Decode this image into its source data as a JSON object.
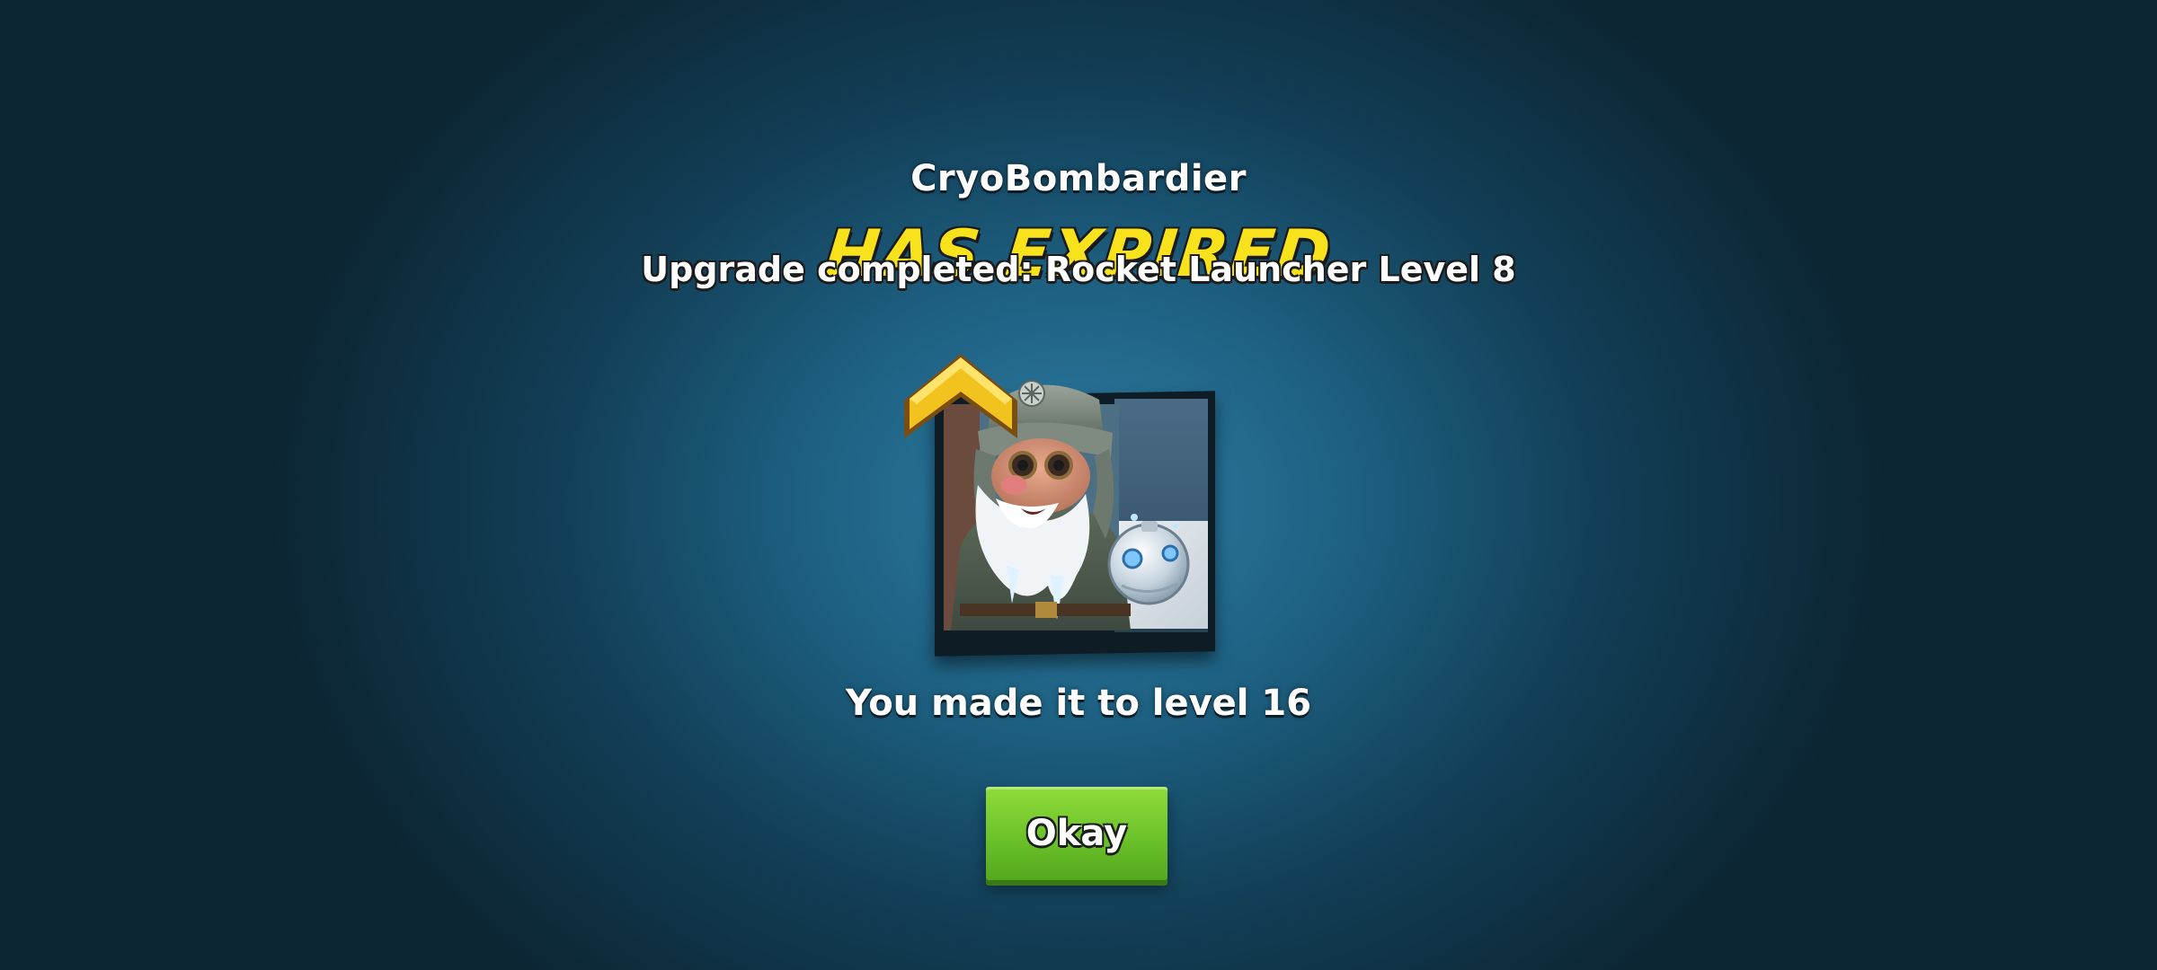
{
  "dialog": {
    "hero_name": "CryoBombardier",
    "expired_banner": "HAS EXPIRED",
    "upgrade_message": "Upgrade completed: Rocket Launcher Level 8",
    "level_message": "You made it to level 16",
    "okay_label": "Okay"
  },
  "portrait": {
    "subject": "cryobombardier-hero-portrait",
    "rank_icon": "rank-up-chevron-icon",
    "bomb_icon": "cryo-bomb-icon"
  },
  "colors": {
    "background_center": "#2f7fa5",
    "background_edge": "#0c2533",
    "banner_yellow": "#f7e21c",
    "button_green": "#6cc22a",
    "chevron_gold": "#e8b81c"
  }
}
